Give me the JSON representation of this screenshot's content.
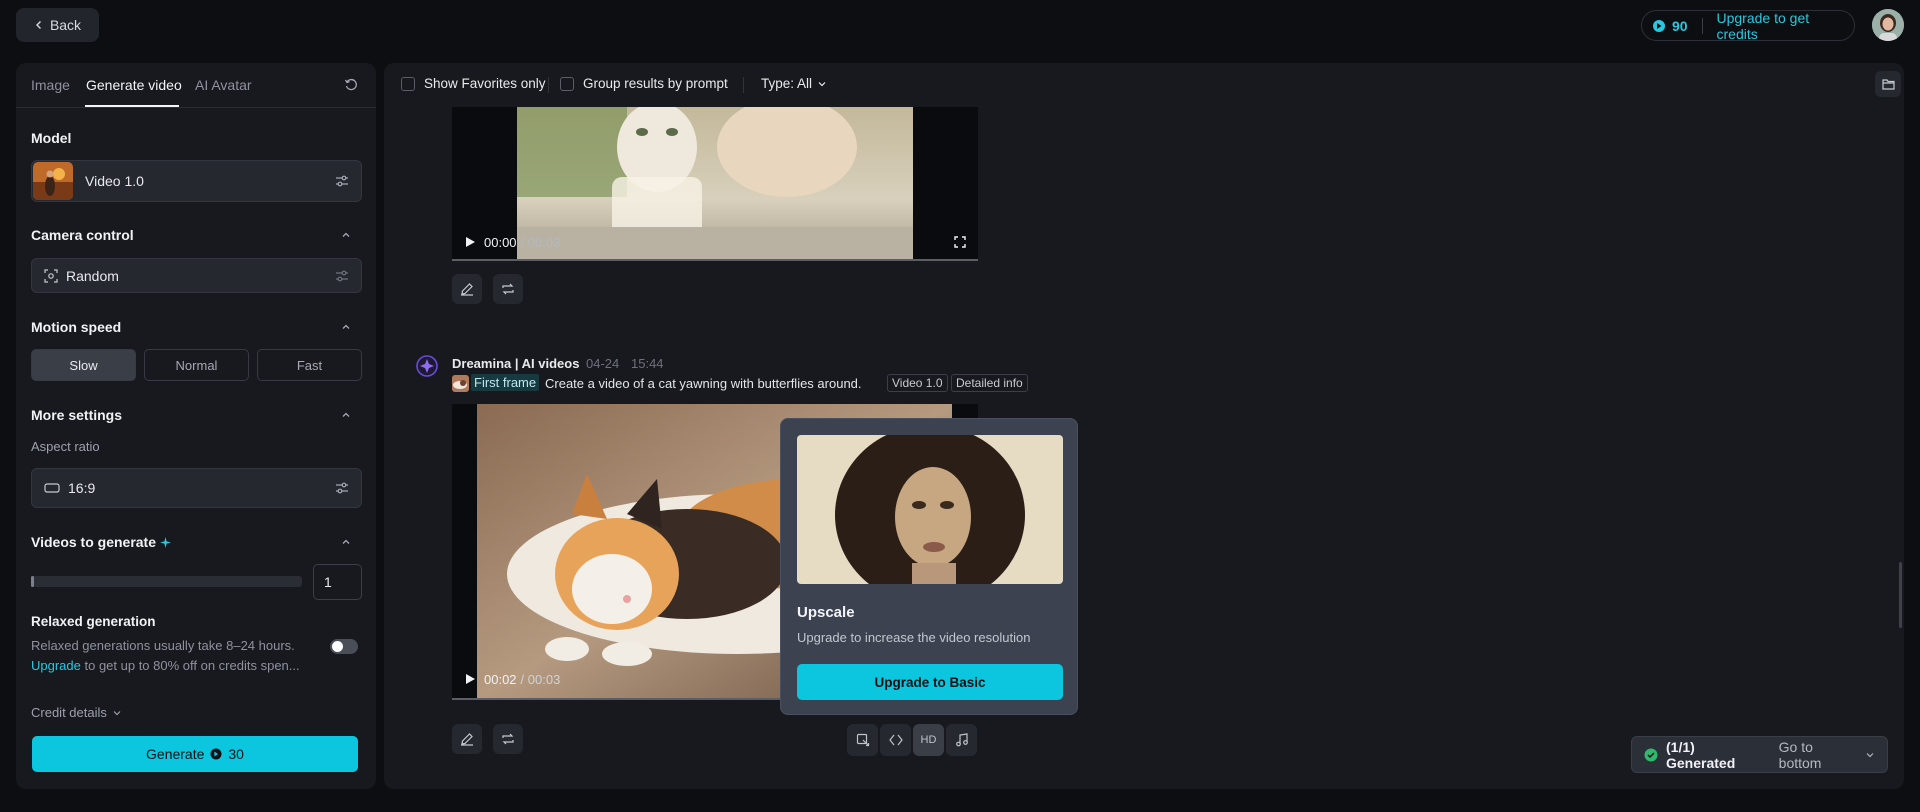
{
  "topbar": {
    "back_label": "Back",
    "credits_count": "90",
    "upgrade_label": "Upgrade to get credits"
  },
  "panel": {
    "tabs": [
      {
        "label": "Image"
      },
      {
        "label": "Generate video"
      },
      {
        "label": "AI Avatar"
      }
    ],
    "model": {
      "title": "Model",
      "value": "Video 1.0"
    },
    "camera": {
      "title": "Camera control",
      "value": "Random"
    },
    "motion": {
      "title": "Motion speed",
      "options": [
        "Slow",
        "Normal",
        "Fast"
      ],
      "selected": "Slow"
    },
    "more": {
      "title": "More settings",
      "aspect_label": "Aspect ratio",
      "aspect_value": "16:9"
    },
    "videos": {
      "title": "Videos to generate",
      "count": "1"
    },
    "relaxed": {
      "title": "Relaxed generation",
      "line1": "Relaxed generations usually take 8–24 hours.",
      "upgrade_link": "Upgrade",
      "line2_rest": " to get up to 80% off on credits spen..."
    },
    "credit_details": "Credit details",
    "generate": {
      "label": "Generate",
      "cost": "30"
    }
  },
  "filters": {
    "favorites": "Show Favorites only",
    "group": "Group results by prompt",
    "type": "Type: All"
  },
  "video1": {
    "time_current": "00:00",
    "time_total": "/ 00:03"
  },
  "post": {
    "author": "Dreamina | AI videos",
    "date": "04-24",
    "time": "15:44",
    "first_frame": "First frame",
    "prompt": "Create a video of a cat yawning with butterflies around.",
    "tag_model": "Video 1.0",
    "tag_info": "Detailed info"
  },
  "video2": {
    "time_current": "00:02",
    "time_total": "/ 00:03"
  },
  "popup": {
    "title": "Upscale",
    "desc": "Upgrade to increase the video resolution",
    "button": "Upgrade to Basic"
  },
  "toolbar": {
    "hd_label": "HD"
  },
  "status": {
    "generated": "(1/1) Generated",
    "goto": "Go to bottom"
  },
  "colors": {
    "accent": "#0bc6de",
    "bg": "#0d0e12",
    "panel": "#17191e"
  }
}
